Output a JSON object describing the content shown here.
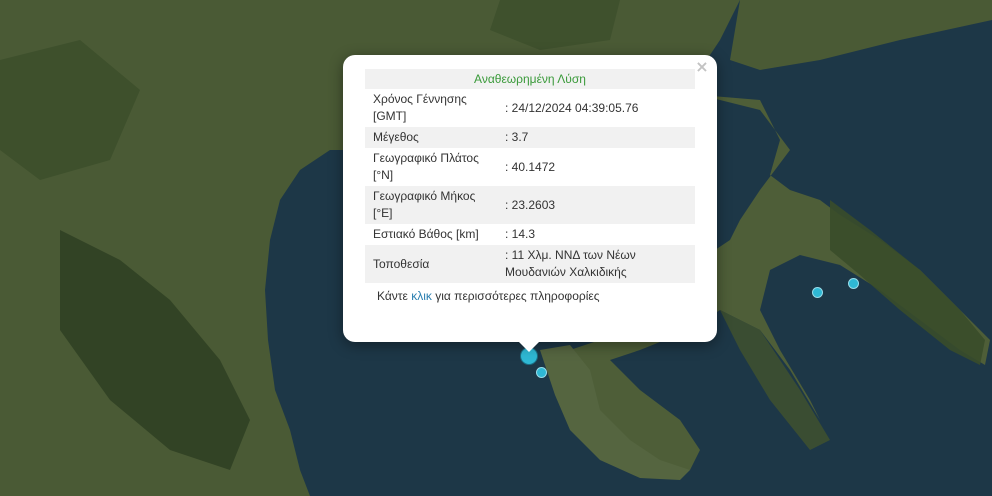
{
  "colors": {
    "sea": "#1d3747",
    "land": "#4a5a35",
    "mountain": "#2c3d22",
    "popup_title": "#3a9a3a",
    "link": "#2a7fb0",
    "marker": "#2fb8d4"
  },
  "popup": {
    "title": "Αναθεωρημένη Λύση",
    "close_symbol": "×",
    "rows": [
      {
        "label": "Χρόνος Γέννησης [GMT]",
        "value": ": 24/12/2024 04:39:05.76"
      },
      {
        "label": "Μέγεθος",
        "value": ": 3.7"
      },
      {
        "label": "Γεωγραφικό Πλάτος [°N]",
        "value": ": 40.1472"
      },
      {
        "label": "Γεωγραφικό Μήκος [°E]",
        "value": ": 23.2603"
      },
      {
        "label": "Εστιακό Βάθος [km]",
        "value": ": 14.3"
      },
      {
        "label": "Τοποθεσία",
        "value": ": 11 Χλμ. ΝΝΔ των Νέων Μουδανιών Χαλκιδικής"
      }
    ],
    "more_prefix": "Κάντε ",
    "more_link": "κλικ",
    "more_suffix": " για περισσότερες πληροφορίες"
  }
}
